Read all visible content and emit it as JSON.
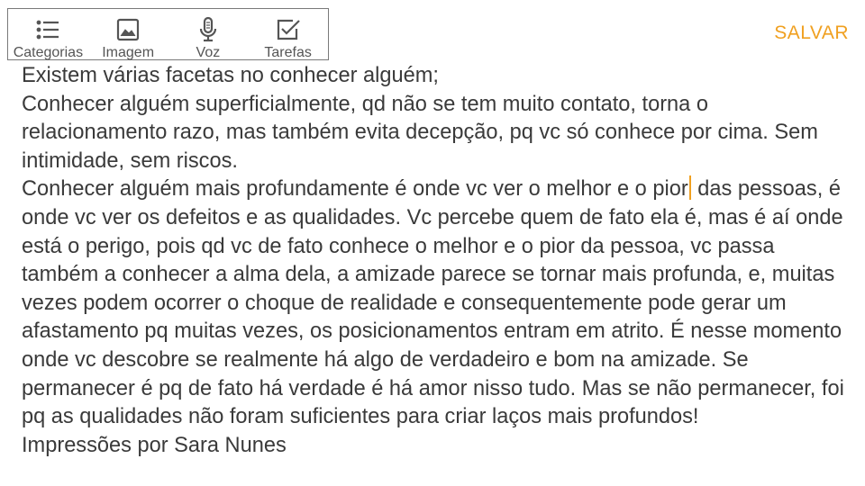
{
  "toolbar": {
    "items": [
      {
        "label": "Categorias",
        "icon": "list-icon"
      },
      {
        "label": "Imagem",
        "icon": "image-icon"
      },
      {
        "label": "Voz",
        "icon": "microphone-icon"
      },
      {
        "label": "Tarefas",
        "icon": "checkbox-icon"
      }
    ],
    "icon_color": "#555555"
  },
  "save_label": "SALVAR",
  "accent_color": "#f0a020",
  "note": {
    "line1": "Existem várias facetas no conhecer alguém;",
    "line2": "Conhecer alguém superficialmente, qd não se tem muito contato, torna o relacionamento razo, mas também evita decepção, pq vc só conhece por cima. Sem intimidade, sem riscos.",
    "line3_before_caret": "Conhecer alguém mais profundamente é onde vc ver o melhor e o pior",
    "line3_after_caret": " das pessoas, é onde vc ver os defeitos e as qualidades. Vc percebe quem de fato ela é, mas é aí onde está o perigo, pois qd vc de fato conhece o melhor e o pior da pessoa, vc passa também a conhecer a alma dela, a amizade parece se tornar mais profunda, e, muitas vezes podem ocorrer o choque de realidade e consequentemente pode gerar um afastamento pq muitas vezes, os posicionamentos entram em atrito. É nesse momento onde vc descobre se realmente há algo de verdadeiro e bom na amizade. Se permanecer é pq de fato há verdade é há amor nisso tudo. Mas se não permanecer, foi pq as qualidades não foram suficientes para criar laços mais profundos!",
    "line4": "Impressões por Sara Nunes"
  }
}
